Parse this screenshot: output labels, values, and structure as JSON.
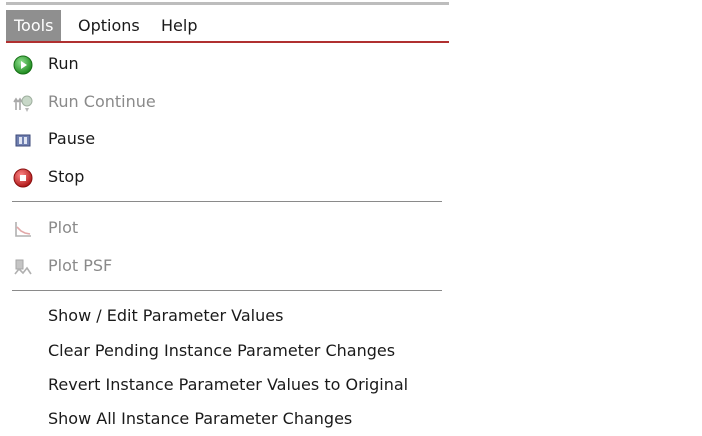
{
  "menubar": {
    "items": [
      {
        "label": "Tools",
        "active": true
      },
      {
        "label": "Options",
        "active": false
      },
      {
        "label": "Help",
        "active": false
      }
    ]
  },
  "tools_menu": {
    "run": {
      "label": "Run",
      "icon": "run-icon",
      "enabled": true
    },
    "run_continue": {
      "label": "Run Continue",
      "icon": "run-continue-icon",
      "enabled": false
    },
    "pause": {
      "label": "Pause",
      "icon": "pause-icon",
      "enabled": true
    },
    "stop": {
      "label": "Stop",
      "icon": "stop-icon",
      "enabled": true
    },
    "plot": {
      "label": "Plot",
      "icon": "plot-icon",
      "enabled": false
    },
    "plot_psf": {
      "label": "Plot PSF",
      "icon": "plot-psf-icon",
      "enabled": false
    },
    "show_edit_params": {
      "label": "Show / Edit Parameter Values",
      "enabled": true
    },
    "clear_pending": {
      "label": "Clear Pending Instance Parameter Changes",
      "enabled": true
    },
    "revert_params": {
      "label": "Revert Instance Parameter Values to Original",
      "enabled": true
    },
    "show_all_changes": {
      "label": "Show All Instance Parameter Changes",
      "enabled": true
    }
  },
  "colors": {
    "accent_rule": "#b03030",
    "active_menu_bg": "#8f8f8f",
    "run_green": "#2ea62e",
    "stop_red": "#d42a2a"
  }
}
